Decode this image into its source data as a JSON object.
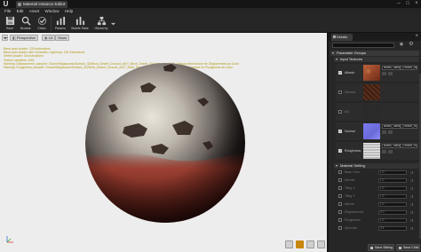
{
  "window": {
    "tab_title": "Material Instance Editor",
    "logo": "U"
  },
  "menu": [
    "File",
    "Edit",
    "Asset",
    "Window",
    "Help"
  ],
  "toolbar": {
    "buttons": [
      {
        "label": "Save",
        "icon": "save-icon"
      },
      {
        "label": "Browse",
        "icon": "browse-icon"
      },
      {
        "label": "Clean",
        "icon": "clean-icon"
      },
      {
        "label": "Params",
        "icon": "params-icon"
      },
      {
        "label": "Mobile Stats",
        "icon": "mobile-stats-icon"
      },
      {
        "label": "Hierarchy",
        "icon": "hierarchy-icon"
      }
    ]
  },
  "viewport": {
    "perspective_label": "Perspective",
    "lit_label": "Lit",
    "show_label": "Show",
    "stats": [
      "Base pass shader: 126 instructions",
      "Base pass shader with Volumetric Lightmap: 130 instructions",
      "Vertex shader: 35 instructions",
      "Texture samplers: 5/16",
      "Warning: Displacement_sampler: /Game/Megascans/Surface_3D/Brick_Desert_Ground_ulh/T_Brick_Desert_Ground_ulh_4K_D: Unsupported texture for Displacement as Color",
      "Warning: Roughness_sampler: /Game/Megascans/Surface_3D/Brick_Desert_Ground_ulh/T_Brick_Desert_Ground_ulh_4K_R: Unsupported texture for Roughness as Color"
    ]
  },
  "details": {
    "tab_label": "Details",
    "search_placeholder": "",
    "groups": {
      "parameter_groups": "Parameter Groups",
      "input_textures": "Input Textures",
      "material_settings": "Material Setting"
    },
    "texture_rows": [
      {
        "label": "Albedo",
        "checked": true,
        "asset": "Bricks_Sandy_Ground_Albedo",
        "enabled": true
      },
      {
        "label": "Normal",
        "checked": false,
        "asset": "",
        "enabled": false
      },
      {
        "label": "AO",
        "checked": false,
        "asset": "",
        "enabled": false
      },
      {
        "label": "Normal",
        "checked": true,
        "asset": "Bricks_Sandy_Ground_Normal",
        "enabled": true
      },
      {
        "label": "Roughness",
        "checked": true,
        "asset": "Bricks_Sandy_Ground_Roughness",
        "enabled": true
      }
    ],
    "param_rows": [
      {
        "label": "Base Color",
        "value": "1.0"
      },
      {
        "label": "Normal",
        "value": "1.0"
      },
      {
        "label": "Tiling X",
        "value": "1.0"
      },
      {
        "label": "Tiling Y",
        "value": "1.0"
      },
      {
        "label": "Albedo",
        "value": "1.0"
      },
      {
        "label": "Displacement",
        "value": "0.0"
      },
      {
        "label": "Roughness",
        "value": "1.0"
      },
      {
        "label": "Specular",
        "value": "0.5"
      }
    ],
    "save_sibling_label": "Save Sibling",
    "save_child_label": "Save Child"
  },
  "colors": {
    "accent_orange": "#c8870f",
    "stats_text": "#b49a12",
    "viewport_bg": "#ededed"
  }
}
